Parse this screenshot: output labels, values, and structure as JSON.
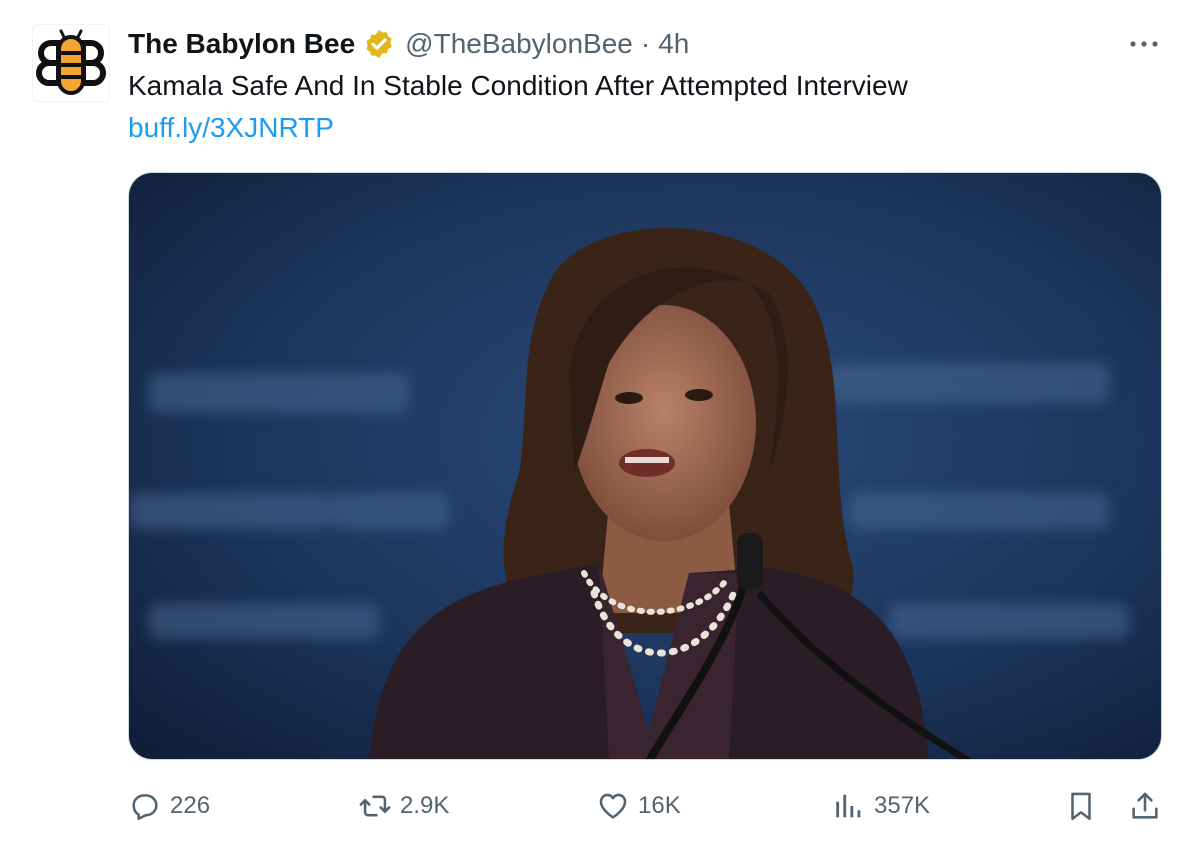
{
  "tweet": {
    "author_name": "The Babylon Bee",
    "handle": "@TheBabylonBee",
    "separator": "·",
    "time": "4h",
    "more_icon": "more-horizontal-icon",
    "text": "Kamala Safe And In Stable Condition After Attempted Interview",
    "link": "buff.ly/3XJNRTP",
    "media_description_icon": "photo-of-speaker-at-microphone",
    "verified_color": "#e2b719",
    "link_color": "#1d9bf0"
  },
  "actions": {
    "reply": {
      "icon": "reply-icon",
      "count": "226"
    },
    "retweet": {
      "icon": "retweet-icon",
      "count": "2.9K"
    },
    "like": {
      "icon": "heart-icon",
      "count": "16K"
    },
    "views": {
      "icon": "views-chart-icon",
      "count": "357K"
    },
    "bookmark": {
      "icon": "bookmark-icon"
    },
    "share": {
      "icon": "share-icon"
    }
  }
}
